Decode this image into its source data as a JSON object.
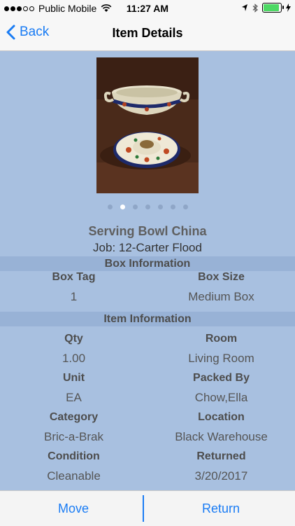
{
  "status_bar": {
    "carrier": "Public Mobile",
    "time": "11:27 AM",
    "signal_dots": 5,
    "signal_filled": 3
  },
  "nav": {
    "back_label": "Back",
    "title": "Item Details"
  },
  "gallery": {
    "page_count": 7,
    "active_index": 1
  },
  "item": {
    "name": "Serving Bowl China",
    "job": "Job: 12-Carter Flood"
  },
  "box_section": {
    "header": "Box Information",
    "tag_label": "Box Tag",
    "tag_value": "1",
    "size_label": "Box Size",
    "size_value": "Medium Box"
  },
  "item_section": {
    "header": "Item Information",
    "qty_label": "Qty",
    "qty_value": "1.00",
    "room_label": "Room",
    "room_value": "Living Room",
    "unit_label": "Unit",
    "unit_value": "EA",
    "packed_by_label": "Packed By",
    "packed_by_value": "Chow,Ella",
    "category_label": "Category",
    "category_value": "Bric-a-Brak",
    "location_label": "Location",
    "location_value": "Black Warehouse",
    "condition_label": "Condition",
    "condition_value": "Cleanable",
    "returned_label": "Returned",
    "returned_value": "3/20/2017"
  },
  "toolbar": {
    "move_label": "Move",
    "return_label": "Return"
  },
  "colors": {
    "accent": "#1a7cf4",
    "background": "#a8c0e0",
    "section_header": "#98b2d6"
  }
}
